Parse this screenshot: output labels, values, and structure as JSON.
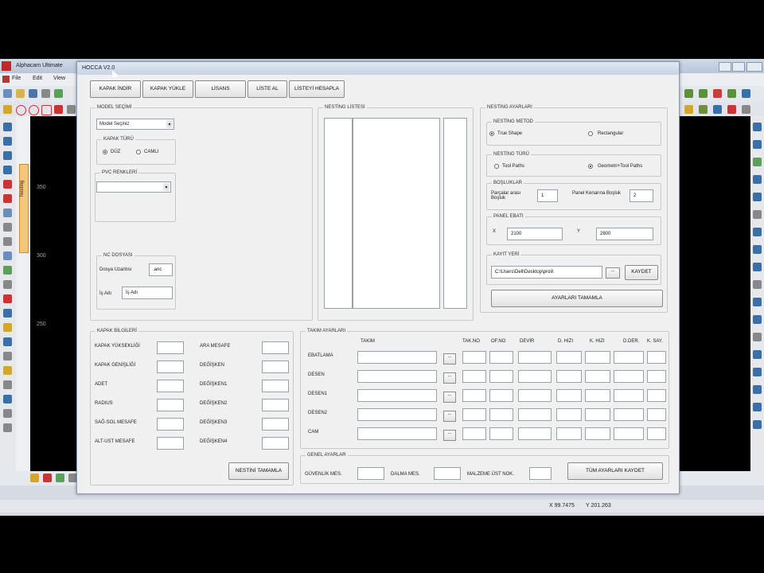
{
  "bg_app": {
    "title": "Alphacam Ultimate",
    "menu": [
      "File",
      "Edit",
      "View"
    ],
    "left_panel_tab": "Nesting",
    "ruler": [
      "350",
      "300",
      "250"
    ],
    "status_x": "X 99.7475",
    "status_y": "Y 201.263"
  },
  "dialog": {
    "title": "HOCCA V2.0",
    "top_buttons": [
      "KAPAK İNDİR",
      "KAPAK YÜKLE",
      "LİSANS",
      "LİSTE AL",
      "LİSTEYİ HESAPLA"
    ],
    "model": {
      "group": "MODEL SEÇİMİ",
      "combo_value": "Model Seçiniz",
      "kapak_turu": "KAPAK TÜRÜ",
      "radio_duz": "DÜZ",
      "radio_camli": "CAMLI",
      "pvc": "PVC RENKLERİ",
      "pvc_value": ""
    },
    "nc": {
      "group": "NC DOSYASI",
      "ext_label": "Dosya Uzantısı",
      "ext_value": ".anc",
      "job_label": "İş Adı",
      "job_value": "İş Adı"
    },
    "nesting_list": {
      "group": "NESTİNG LİSTESİ"
    },
    "nesting_settings": {
      "group": "NESTİNG AYARLARI",
      "method_group": "NESTİNG METOD",
      "true_shape": "True Shape",
      "rectangular": "Rectangular",
      "type_group": "NESTİNG TÜRÜ",
      "tool_paths": "Tool Paths",
      "geom_tool": "Geometri+Tool Paths",
      "gaps_group": "BOŞLUKLAR",
      "parts_gap_label": "Parçalar arası Boşluk",
      "parts_gap_value": "1",
      "panel_edge_label": "Panel Kenarına Boşluk",
      "panel_edge_value": "2",
      "panel_group": "PANEL EBATI",
      "x_label": "X",
      "x_value": "2100",
      "y_label": "Y",
      "y_value": "2800",
      "save_group": "KAYIT YERİ",
      "save_path": "C:\\Users\\Dell\\Desktop\\proli\\",
      "browse": "...",
      "save_btn": "KAYDET",
      "finish_btn": "AYARLARI TAMAMLA"
    },
    "cover_info": {
      "group": "KAPAK BİLGİLERİ",
      "left_labels": [
        "KAPAK YÜKSEKLİĞİ",
        "KAPAK GENİŞLİĞİ",
        "ADET",
        "RADIUS",
        "SAĞ-SOL MESAFE",
        "ALT-UST MESAFE"
      ],
      "right_labels": [
        "ARA MESAFE",
        "DEĞİŞKEN",
        "DEĞİŞKEN1",
        "DEĞİŞKEN2",
        "DEĞİŞKEN3",
        "DEĞİŞKEN4"
      ],
      "finish_btn": "NESTİNİ TAMAMLA"
    },
    "tool_settings": {
      "group": "TAKIM AYARLARI",
      "headers": [
        "TAKIM",
        "TAK.NO",
        "OF.NO",
        "DEVİR",
        "D. HIZI",
        "K. HIZI",
        "D.DER.",
        "K. SAY."
      ],
      "rows": [
        "EBATLAMA",
        "DESEN",
        "DESEN1",
        "DESEN2",
        "CAM"
      ],
      "browse": "..."
    },
    "general": {
      "group": "GENEL AYARLAR",
      "safety": "GÜVENLİK MES.",
      "dive": "DALMA MES.",
      "material": "MALZEME ÜST NOK.",
      "save_all": "TÜM AYARLARI KAYDET"
    }
  }
}
